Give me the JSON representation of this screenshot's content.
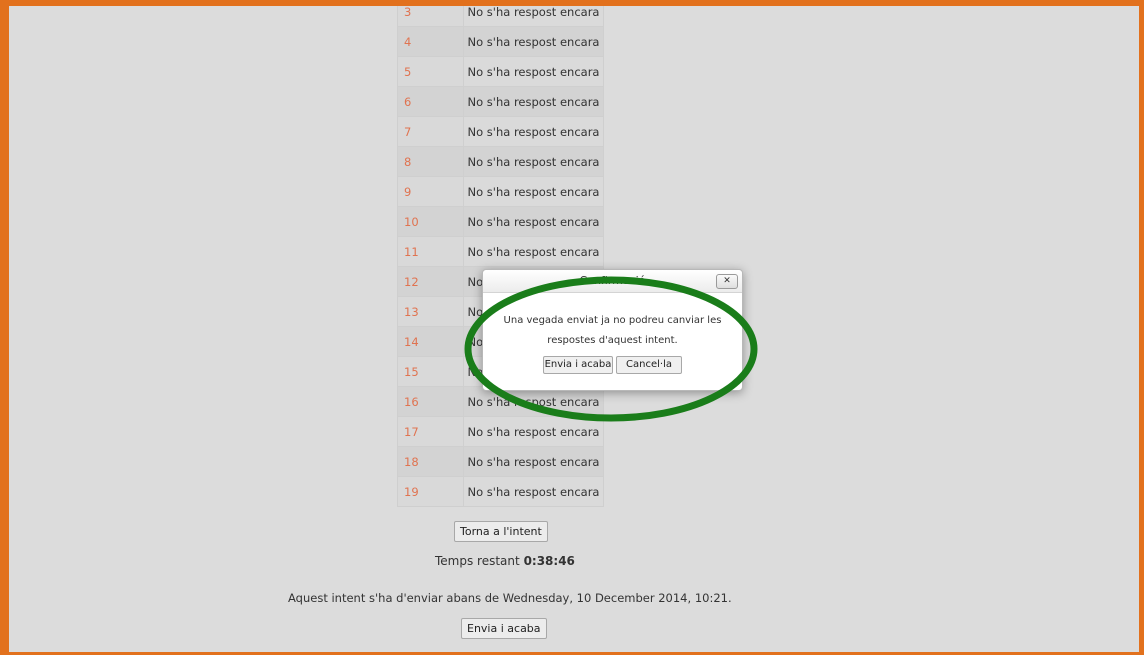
{
  "summary_rows": [
    {
      "num": "3",
      "status": "No s'ha respost encara"
    },
    {
      "num": "4",
      "status": "No s'ha respost encara"
    },
    {
      "num": "5",
      "status": "No s'ha respost encara"
    },
    {
      "num": "6",
      "status": "No s'ha respost encara"
    },
    {
      "num": "7",
      "status": "No s'ha respost encara"
    },
    {
      "num": "8",
      "status": "No s'ha respost encara"
    },
    {
      "num": "9",
      "status": "No s'ha respost encara"
    },
    {
      "num": "10",
      "status": "No s'ha respost encara"
    },
    {
      "num": "11",
      "status": "No s'ha respost encara"
    },
    {
      "num": "12",
      "status": "No s'ha respost encara"
    },
    {
      "num": "13",
      "status": "No s'ha respost encara"
    },
    {
      "num": "14",
      "status": "No s'ha respost encara"
    },
    {
      "num": "15",
      "status": "No s'ha respost encara"
    },
    {
      "num": "16",
      "status": "No s'ha respost encara"
    },
    {
      "num": "17",
      "status": "No s'ha respost encara"
    },
    {
      "num": "18",
      "status": "No s'ha respost encara"
    },
    {
      "num": "19",
      "status": "No s'ha respost encara"
    }
  ],
  "return_button": "Torna a l'intent",
  "timer": {
    "label": "Temps restant",
    "value": "0:38:46"
  },
  "deadline_text": "Aquest intent s'ha d'enviar abans de Wednesday, 10 December 2014, 10:21.",
  "submit_button": "Envia i acaba",
  "dialog": {
    "title": "Confirmació",
    "close_icon": "close-icon",
    "message_line1": "Una vegada enviat ja no podreu canviar les",
    "message_line2": "respostes d'aquest intent.",
    "confirm_button": "Envia i acaba",
    "cancel_button": "Cancel·la"
  },
  "colors": {
    "frame_border": "#e2711d",
    "question_number": "#e07350",
    "highlight_ellipse": "#1a7d1a"
  }
}
